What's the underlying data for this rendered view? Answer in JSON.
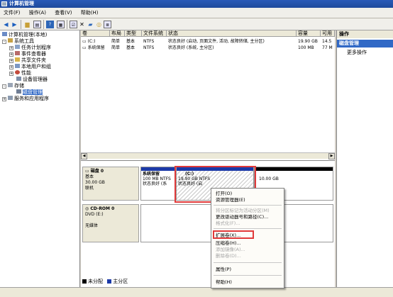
{
  "window": {
    "title": "计算机管理"
  },
  "menu": [
    "文件(F)",
    "操作(A)",
    "查看(V)",
    "帮助(H)"
  ],
  "toolbar": {
    "icons": [
      "back-arrow-icon",
      "forward-arrow-icon",
      "folder-icon",
      "properties-icon",
      "help-icon",
      "refresh-icon",
      "delete-icon",
      "settings-icon",
      "search-icon",
      "export-icon"
    ]
  },
  "tree": {
    "root": "计算机管理(本地)",
    "system_tools": "系统工具",
    "task_scheduler": "任务计划程序",
    "event_viewer": "事件查看器",
    "shared_folders": "共享文件夹",
    "local_users": "本地用户和组",
    "performance": "性能",
    "device_manager": "设备管理器",
    "storage": "存储",
    "disk_management": "磁盘管理",
    "services_apps": "服务和应用程序"
  },
  "volume_table": {
    "columns": [
      "卷",
      "布局",
      "类型",
      "文件系统",
      "状态",
      "容量",
      "可用"
    ],
    "rows": [
      {
        "volume": "(C:)",
        "layout": "简单",
        "type": "基本",
        "fs": "NTFS",
        "status": "状态良好 (启动, 页面文件, 活动, 故障转储, 主分区)",
        "capacity": "19.90 GB",
        "free": "14.5"
      },
      {
        "volume": "系统保留",
        "layout": "简单",
        "type": "基本",
        "fs": "NTFS",
        "status": "状态良好 (系统, 主分区)",
        "capacity": "100 MB",
        "free": "77 M"
      }
    ]
  },
  "disks": {
    "disk0": {
      "name": "磁盘 0",
      "type": "基本",
      "size": "30.00 GB",
      "state": "联机"
    },
    "cdrom0": {
      "name": "CD-ROM 0",
      "type": "DVD (E:)",
      "state": "无媒体"
    }
  },
  "partitions": {
    "reserved": {
      "name": "系统保留",
      "size": "100 MB NTFS",
      "status": "状态良好 (系"
    },
    "c": {
      "name": "(C:)",
      "size": "19.90 GB NTFS",
      "status": "状态良好 (启"
    },
    "unalloc": {
      "size": "10.00 GB"
    }
  },
  "legend": {
    "unallocated": "未分配",
    "primary": "主分区"
  },
  "actions": {
    "title": "操作",
    "section": "磁盘管理",
    "more": "更多操作"
  },
  "context_menu": {
    "open": "打开(O)",
    "explore": "资源管理器(E)",
    "mark_active": "将分区标记为活动分区(M)",
    "change_letter": "更改驱动器号和路径(C)...",
    "format": "格式化(F)...",
    "extend": "扩展卷(X)...",
    "shrink": "压缩卷(H)...",
    "add_mirror": "添加镜像(A)...",
    "delete": "删除卷(D)...",
    "properties": "属性(P)",
    "help": "帮助(H)"
  },
  "colors": {
    "primary_partition": "#1c3aa8",
    "unallocated": "#000000",
    "highlight": "#e13a3a",
    "selection": "#3169c6"
  }
}
